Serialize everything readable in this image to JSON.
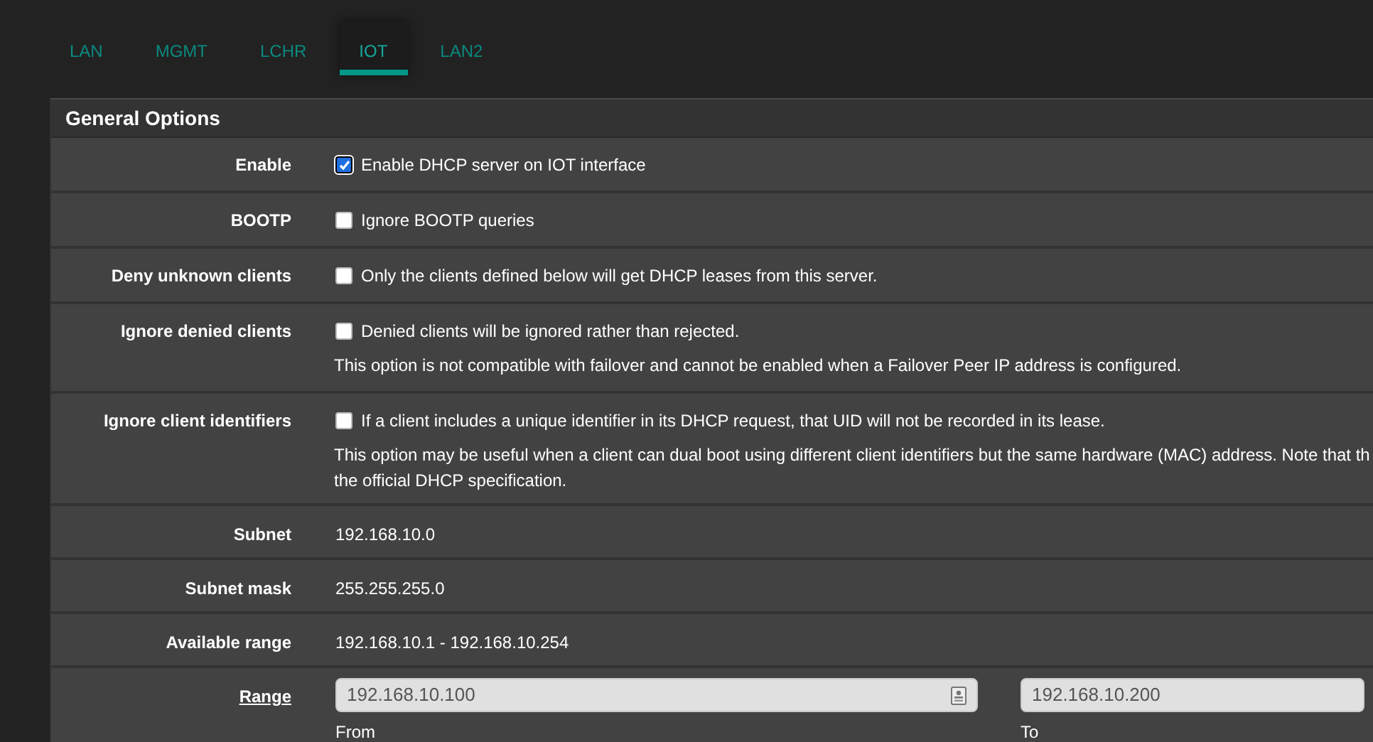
{
  "tabs": [
    {
      "label": "LAN",
      "selected": false
    },
    {
      "label": "MGMT",
      "selected": false
    },
    {
      "label": "LCHR",
      "selected": false
    },
    {
      "label": "IOT",
      "selected": true
    },
    {
      "label": "LAN2",
      "selected": false
    }
  ],
  "panel": {
    "title": "General Options",
    "rows": [
      {
        "kind": "checkbox",
        "label": "Enable",
        "checked": true,
        "text": "Enable DHCP server on IOT interface"
      },
      {
        "kind": "checkbox",
        "label": "BOOTP",
        "checked": false,
        "text": "Ignore BOOTP queries"
      },
      {
        "kind": "checkbox",
        "label": "Deny unknown clients",
        "checked": false,
        "text": "Only the clients defined below will get DHCP leases from this server."
      },
      {
        "kind": "checkbox",
        "label": "Ignore denied clients",
        "checked": false,
        "text": "Denied clients will be ignored rather than rejected.",
        "help": [
          "This option is not compatible with failover and cannot be enabled when a Failover Peer IP address is configured."
        ]
      },
      {
        "kind": "checkbox",
        "label": "Ignore client identifiers",
        "checked": false,
        "text": "If a client includes a unique identifier in its DHCP request, that UID will not be recorded in its lease.",
        "help": [
          "This option may be useful when a client can dual boot using different client identifiers but the same hardware (MAC) address. Note that th",
          "the official DHCP specification."
        ]
      },
      {
        "kind": "text",
        "label": "Subnet",
        "value": "192.168.10.0"
      },
      {
        "kind": "text",
        "label": "Subnet mask",
        "value": "255.255.255.0"
      },
      {
        "kind": "text",
        "label": "Available range",
        "value": "192.168.10.1 - 192.168.10.254"
      },
      {
        "kind": "range",
        "label": "Range",
        "from": {
          "value": "192.168.10.100",
          "caption": "From"
        },
        "to": {
          "value": "192.168.10.200",
          "caption": "To"
        }
      }
    ]
  }
}
